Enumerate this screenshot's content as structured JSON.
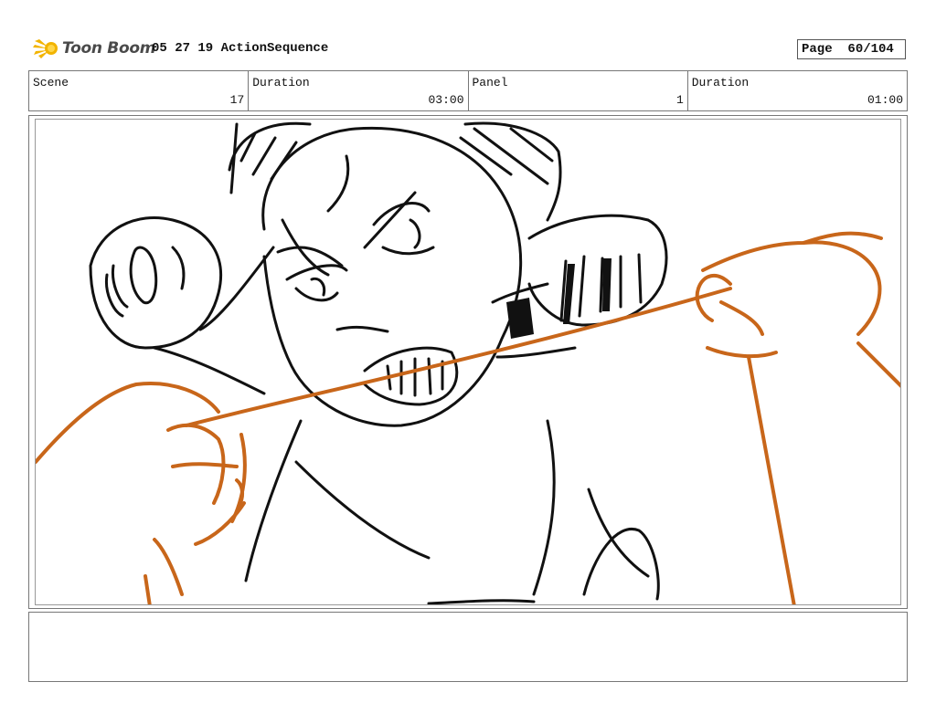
{
  "header": {
    "logo_text": "Toon Boom",
    "doc_title": "05 27 19 ActionSequence",
    "page_label": "Page",
    "page_value": "60/104"
  },
  "info": {
    "scene_label": "Scene",
    "scene_value": "17",
    "duration_label": "Duration",
    "duration_value": "03:00",
    "panel_label": "Panel",
    "panel_value": "1",
    "panel_duration_label": "Duration",
    "panel_duration_value": "01:00"
  },
  "sketch": {
    "line_color": "#111111",
    "accent_color": "#c8661a"
  },
  "notes": {
    "text": ""
  }
}
